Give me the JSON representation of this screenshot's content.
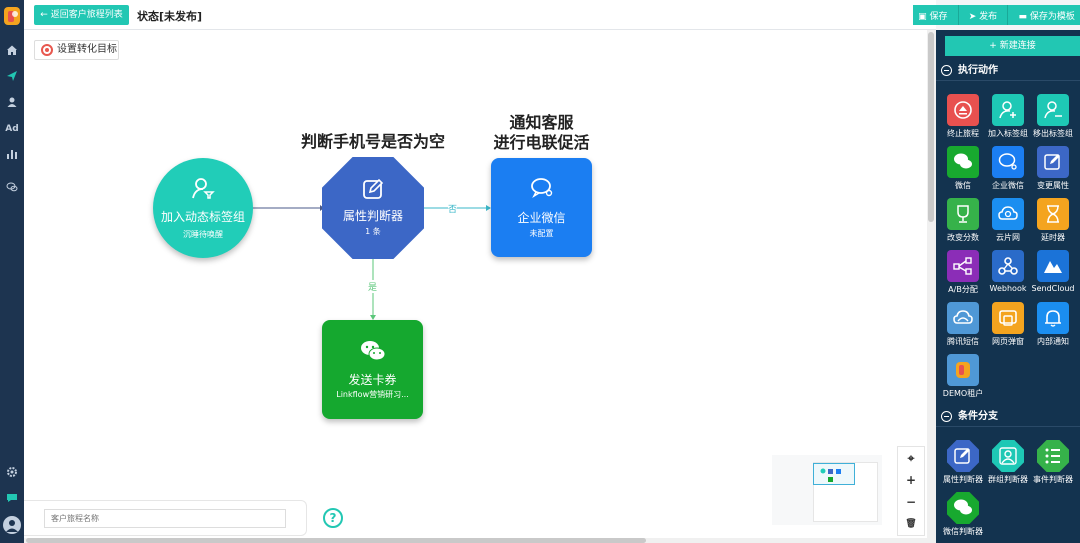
{
  "topbar": {
    "back_label": "返回客户旅程列表",
    "status_title": "状态[未发布]"
  },
  "actions": {
    "save": "保存",
    "publish": "发布",
    "save_template": "保存为模板"
  },
  "canvas": {
    "goal_label": "设置转化目标",
    "nodes": {
      "tag": {
        "title": "加入动态标签组",
        "sub": "沉睡待唤醒"
      },
      "attr": {
        "label": "判断手机号是否为空",
        "title": "属性判断器",
        "sub": "1 条"
      },
      "wecom": {
        "label_line1": "通知客服",
        "label_line2": "进行电联促活",
        "title": "企业微信",
        "sub": "未配置"
      },
      "card": {
        "title": "发送卡券",
        "sub": "Linkflow营销研习..."
      }
    },
    "edges": {
      "no": "否",
      "yes": "是"
    },
    "zoom": {
      "locate": "⌖",
      "in": "+",
      "out": "−",
      "delete": "🗑"
    }
  },
  "bottom": {
    "name_placeholder": "客户旅程名称"
  },
  "panel": {
    "new_link": "+ 新建连接",
    "section_actions": "执行动作",
    "section_branches": "条件分支",
    "actions": [
      {
        "label": "终止旅程",
        "color": "#e8514f"
      },
      {
        "label": "加入标签组",
        "color": "#1ec8b5"
      },
      {
        "label": "移出标签组",
        "color": "#1ec8b5"
      },
      {
        "label": "微信",
        "color": "#18a92f"
      },
      {
        "label": "企业微信",
        "color": "#1b7ef2"
      },
      {
        "label": "变更属性",
        "color": "#3c67c6"
      },
      {
        "label": "改变分数",
        "color": "#36b24a"
      },
      {
        "label": "云片网",
        "color": "#1b8ef0"
      },
      {
        "label": "延时器",
        "color": "#f4a41f"
      },
      {
        "label": "A/B分配",
        "color": "#8b2db7"
      },
      {
        "label": "Webhook",
        "color": "#2a6bc9"
      },
      {
        "label": "SendCloud",
        "color": "#1b73d8"
      },
      {
        "label": "腾讯短信",
        "color": "#4f98d6"
      },
      {
        "label": "网页弹窗",
        "color": "#f4a41f"
      },
      {
        "label": "内部通知",
        "color": "#1b8ef0"
      },
      {
        "label": "DEMO租户",
        "color": "#4f98d6"
      }
    ],
    "branches": [
      {
        "label": "属性判断器",
        "color": "#3c67c6"
      },
      {
        "label": "群组判断器",
        "color": "#1ec8b5"
      },
      {
        "label": "事件判断器",
        "color": "#36b24a"
      },
      {
        "label": "微信判断器",
        "color": "#18a92f"
      }
    ]
  }
}
